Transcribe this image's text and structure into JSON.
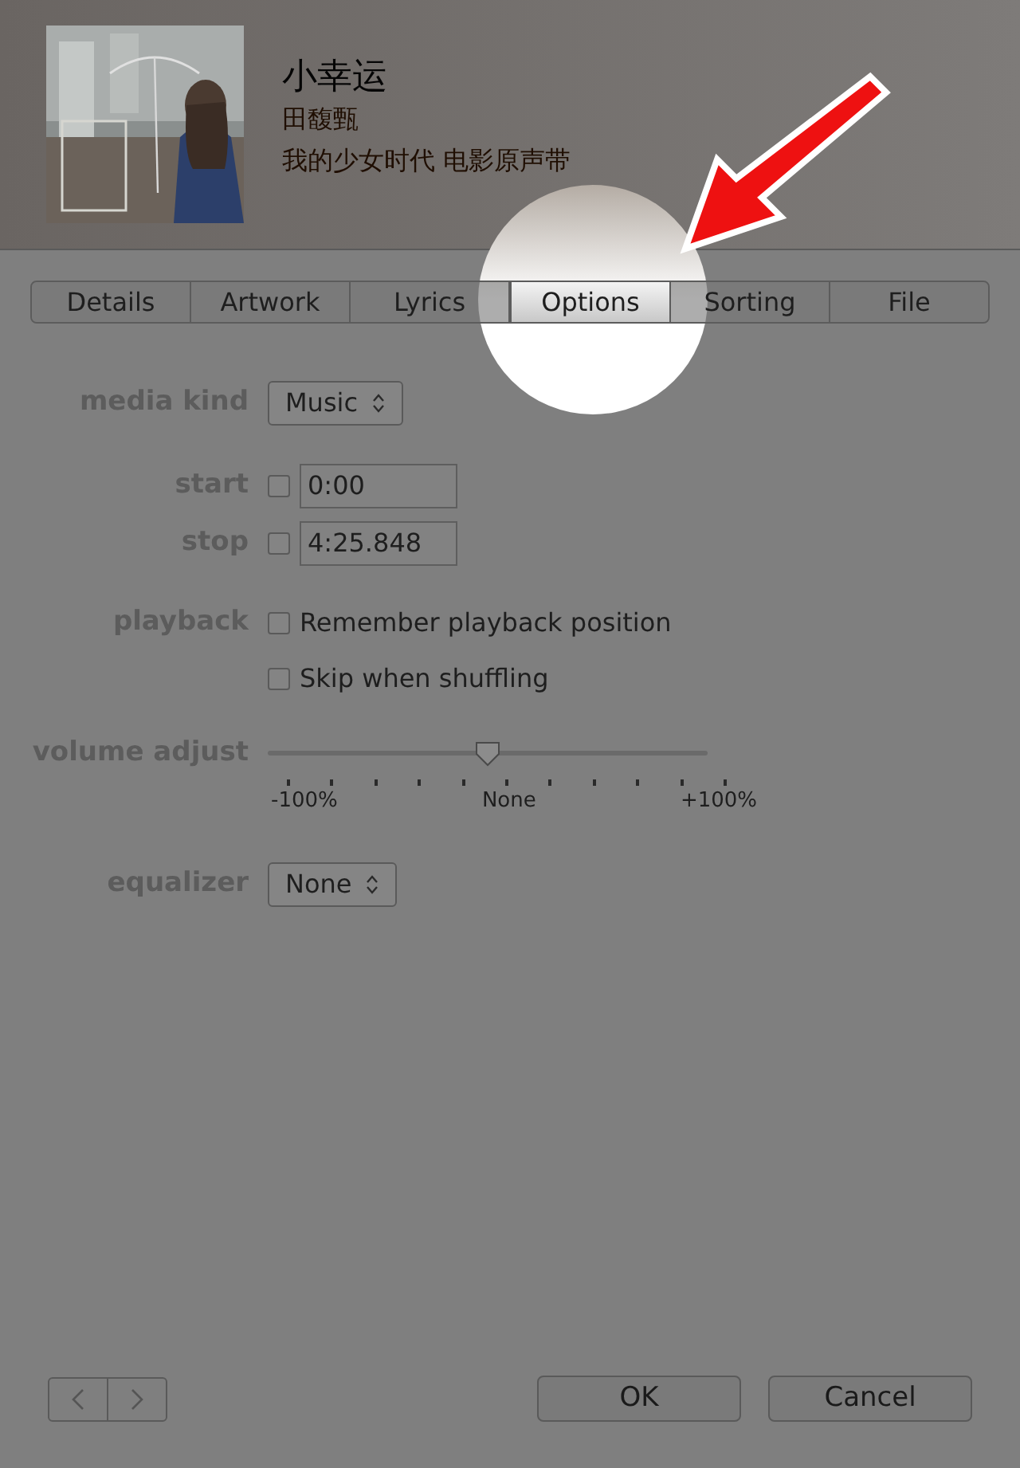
{
  "track": {
    "title": "小幸运",
    "artist": "田馥甄",
    "album": "我的少女时代 电影原声带"
  },
  "tabs": [
    {
      "label": "Details",
      "selected": false
    },
    {
      "label": "Artwork",
      "selected": false
    },
    {
      "label": "Lyrics",
      "selected": false
    },
    {
      "label": "Options",
      "selected": true
    },
    {
      "label": "Sorting",
      "selected": false
    },
    {
      "label": "File",
      "selected": false
    }
  ],
  "options": {
    "media_kind": {
      "label": "media kind",
      "value": "Music"
    },
    "start": {
      "label": "start",
      "checked": false,
      "value": "0:00"
    },
    "stop": {
      "label": "stop",
      "checked": false,
      "value": "4:25.848"
    },
    "playback": {
      "label": "playback",
      "options": [
        {
          "label": "Remember playback position",
          "checked": false
        },
        {
          "label": "Skip when shuffling",
          "checked": false
        }
      ]
    },
    "volume": {
      "label": "volume adjust",
      "level": 0.5,
      "min_label": "-100%",
      "mid_label": "None",
      "max_label": "+100%"
    },
    "equalizer": {
      "label": "equalizer",
      "value": "None"
    }
  },
  "buttons": [
    "OK",
    "Cancel"
  ]
}
